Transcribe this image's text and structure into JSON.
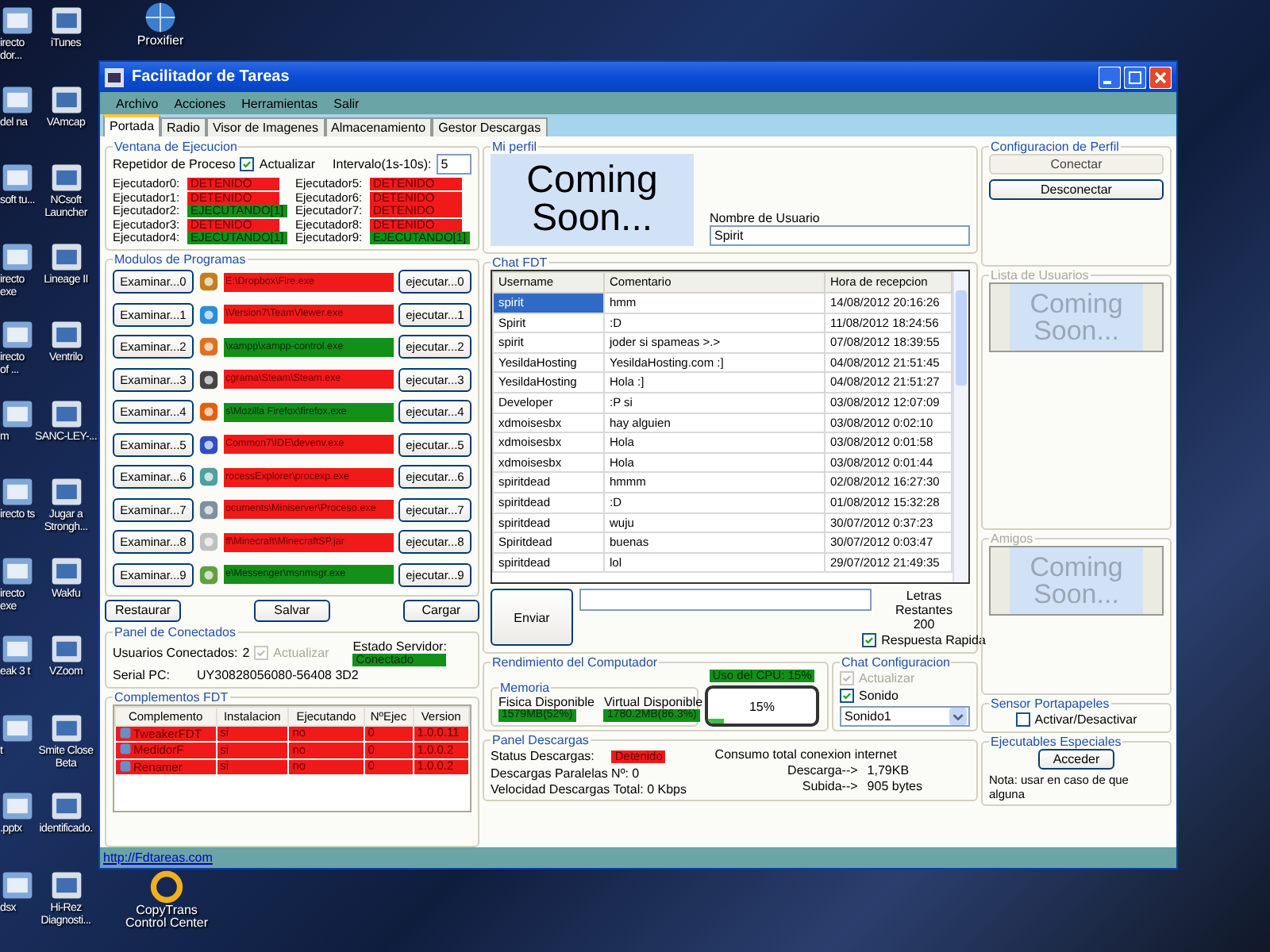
{
  "desktop": {
    "left_column": [
      {
        "label": "irecto dor..."
      },
      {
        "label": "del na"
      },
      {
        "label": "soft tu..."
      },
      {
        "label": "irecto exe"
      },
      {
        "label": "irecto of ..."
      },
      {
        "label": "m"
      },
      {
        "label": "irecto ts"
      },
      {
        "label": "irecto exe"
      },
      {
        "label": "eak 3 t"
      },
      {
        "label": "t"
      },
      {
        "label": ".pptx"
      },
      {
        "label": "dsx"
      }
    ],
    "second_column": [
      {
        "label": "iTunes"
      },
      {
        "label": "VAmcap"
      },
      {
        "label": "NCsoft Launcher"
      },
      {
        "label": "Lineage II"
      },
      {
        "label": "Ventrilo"
      },
      {
        "label": "SANC-LEY-..."
      },
      {
        "label": "Jugar a Strongh..."
      },
      {
        "label": "Wakfu"
      },
      {
        "label": "VZoom"
      },
      {
        "label": "Smite Close Beta"
      },
      {
        "label": "identificado."
      },
      {
        "label": "Hi-Rez Diagnosti..."
      }
    ],
    "top_icons": [
      {
        "label": "Proxifier"
      }
    ],
    "bottom_icons": [
      {
        "label": "CopyTrans Control Center"
      }
    ]
  },
  "window": {
    "title": "Facilitador de Tareas",
    "menu": [
      "Archivo",
      "Acciones",
      "Herramientas",
      "Salir"
    ],
    "tabs": [
      {
        "label": "Portada",
        "selected": true
      },
      {
        "label": "Radio",
        "selected": false
      },
      {
        "label": "Visor de Imagenes",
        "selected": false
      },
      {
        "label": "Almacenamiento",
        "selected": false
      },
      {
        "label": "Gestor Descargas",
        "selected": false
      }
    ],
    "link": "http://Fdtareas.com"
  },
  "ventana_ejecucion": {
    "title": "Ventana de Ejecucion",
    "repetidor": "Repetidor de Proceso",
    "actualizar": {
      "label": "Actualizar",
      "checked": true
    },
    "intervalo_label": "Intervalo(1s-10s):",
    "intervalo": "5",
    "executors": [
      {
        "label": "Ejecutador0:",
        "status": "DETENIDO",
        "running": false
      },
      {
        "label": "Ejecutador1:",
        "status": "DETENIDO",
        "running": false
      },
      {
        "label": "Ejecutador2:",
        "status": "EJECUTANDO[1]",
        "running": true
      },
      {
        "label": "Ejecutador3:",
        "status": "DETENIDO",
        "running": false
      },
      {
        "label": "Ejecutador4:",
        "status": "EJECUTANDO[1]",
        "running": true
      },
      {
        "label": "Ejecutador5:",
        "status": "DETENIDO",
        "running": false
      },
      {
        "label": "Ejecutador6:",
        "status": "DETENIDO",
        "running": false
      },
      {
        "label": "Ejecutador7:",
        "status": "DETENIDO",
        "running": false
      },
      {
        "label": "Ejecutador8:",
        "status": "DETENIDO",
        "running": false
      },
      {
        "label": "Ejecutador9:",
        "status": "EJECUTANDO[1]",
        "running": true
      }
    ]
  },
  "modulos": {
    "title": "Modulos de Programas",
    "rows": [
      {
        "browse": "Examinar...0",
        "path": "E:\\Dropbox\\Fire.exe",
        "running": false,
        "run": "ejecutar...0"
      },
      {
        "browse": "Examinar...1",
        "path": "\\Version7\\TeamViewer.exe",
        "running": false,
        "run": "ejecutar...1"
      },
      {
        "browse": "Examinar...2",
        "path": "\\xampp\\xampp-control.exe",
        "running": true,
        "run": "ejecutar...2"
      },
      {
        "browse": "Examinar...3",
        "path": "cgrama\\Steam\\Steam.exe",
        "running": false,
        "run": "ejecutar...3"
      },
      {
        "browse": "Examinar...4",
        "path": "s\\Mozilla Firefox\\firefox.exe",
        "running": true,
        "run": "ejecutar...4"
      },
      {
        "browse": "Examinar...5",
        "path": "Common7\\IDE\\devenv.exe",
        "running": false,
        "run": "ejecutar...5"
      },
      {
        "browse": "Examinar...6",
        "path": "rocessExplorer\\procexp.exe",
        "running": false,
        "run": "ejecutar...6"
      },
      {
        "browse": "Examinar...7",
        "path": "ocuments\\Miniserver\\Proceso.exe",
        "running": false,
        "run": "ejecutar...7"
      },
      {
        "browse": "Examinar...8",
        "path": "ff\\Minecraft\\MinecraftSP.jar",
        "running": false,
        "run": "ejecutar...8"
      },
      {
        "browse": "Examinar...9",
        "path": "e\\Messenger\\msnmsgr.exe",
        "running": true,
        "run": "ejecutar...9"
      }
    ],
    "buttons": [
      "Restaurar",
      "Salvar",
      "Cargar"
    ]
  },
  "conectados": {
    "title": "Panel de Conectados",
    "usuarios_label": "Usuarios Conectados:",
    "usuarios": "2",
    "actualizar": {
      "label": "Actualizar",
      "checked": true,
      "disabled": true
    },
    "estado_label": "Estado Servidor:",
    "estado": "Conectado",
    "estado_ok": true,
    "serial_label": "Serial PC:",
    "serial": "UY30828056080-56408 3D2"
  },
  "complementos": {
    "title": "Complementos FDT",
    "columns": [
      "Complemento",
      "Instalacion",
      "Ejecutando",
      "NºEjec",
      "Version"
    ],
    "rows": [
      {
        "cells": [
          "TweakerFDT",
          "si",
          "no",
          "0",
          "1.0.0.11"
        ],
        "running": false
      },
      {
        "cells": [
          "MedidorF",
          "si",
          "no",
          "0",
          "1.0.0.2"
        ],
        "running": false
      },
      {
        "cells": [
          "Renamer",
          "si",
          "no",
          "0",
          "1.0.0.2"
        ],
        "running": false
      }
    ]
  },
  "perfil": {
    "title": "Mi perfil",
    "coming_soon": "Coming Soon...",
    "usuario_label": "Nombre de Usuario",
    "usuario": "Spirit"
  },
  "chat": {
    "title": "Chat FDT",
    "columns": [
      "Username",
      "Comentario",
      "Hora de recepcion"
    ],
    "rows": [
      {
        "username": "spirit",
        "comment": "hmm",
        "time": "14/08/2012 20:16:26",
        "selected": true
      },
      {
        "username": "Spirit",
        "comment": ":D",
        "time": "11/08/2012 18:24:56",
        "selected": false
      },
      {
        "username": "spirit",
        "comment": "joder si spameas >.>",
        "time": "07/08/2012 18:39:55",
        "selected": false
      },
      {
        "username": "YesildaHosting",
        "comment": "YesildaHosting.com :]",
        "time": "04/08/2012 21:51:45",
        "selected": false
      },
      {
        "username": "YesildaHosting",
        "comment": "Hola :]",
        "time": "04/08/2012 21:51:27",
        "selected": false
      },
      {
        "username": "Developer",
        "comment": ":P si",
        "time": "03/08/2012 12:07:09",
        "selected": false
      },
      {
        "username": "xdmoisesbx",
        "comment": "hay alguien",
        "time": "03/08/2012 0:02:10",
        "selected": false
      },
      {
        "username": "xdmoisesbx",
        "comment": "Hola",
        "time": "03/08/2012 0:01:58",
        "selected": false
      },
      {
        "username": "xdmoisesbx",
        "comment": "Hola",
        "time": "03/08/2012 0:01:44",
        "selected": false
      },
      {
        "username": "spiritdead",
        "comment": "hmmm",
        "time": "02/08/2012 16:27:30",
        "selected": false
      },
      {
        "username": "spiritdead",
        "comment": ":D",
        "time": "01/08/2012 15:32:28",
        "selected": false
      },
      {
        "username": "spiritdead",
        "comment": "wuju",
        "time": "30/07/2012 0:37:23",
        "selected": false
      },
      {
        "username": "Spiritdead",
        "comment": "buenas",
        "time": "30/07/2012 0:03:47",
        "selected": false
      },
      {
        "username": "spiritdead",
        "comment": "lol",
        "time": "29/07/2012 21:49:35",
        "selected": false
      }
    ],
    "send": "Enviar",
    "letras_label": "Letras Restantes",
    "letras": "200",
    "respuesta": {
      "label": "Respuesta Rapida",
      "checked": true
    }
  },
  "rendimiento": {
    "title": "Rendimiento del Computador",
    "memoria": "Memoria",
    "fisica_label": "Fisica Disponible",
    "fisica": "1579MB(52%)",
    "virtual_label": "Virtual Disponible",
    "virtual": "1780.2MB(86.3%)",
    "cpu_label": "Uso del CPU: 15%",
    "cpu": {
      "reading": "15%",
      "level": 0.15
    }
  },
  "chat_config": {
    "title": "Chat Configuracion",
    "actualizar": {
      "label": "Actualizar",
      "checked": true,
      "disabled": true
    },
    "sonido": {
      "label": "Sonido",
      "checked": true,
      "disabled": false
    },
    "sound": "Sonido1"
  },
  "descargas": {
    "title": "Panel Descargas",
    "status_label": "Status Descargas:",
    "status": "Detenido",
    "status_ok": false,
    "paralelas": "Descargas Paralelas Nº: 0",
    "velocidad": "Velocidad Descargas Total: 0 Kbps",
    "consumo": "Consumo total conexion internet",
    "descarga_label": "Descarga-->",
    "descarga": "1,79KB",
    "subida_label": "Subida-->",
    "subida": "905 bytes"
  },
  "config_perfil": {
    "title": "Configuracion de Perfil",
    "conectar": {
      "label": "Conectar",
      "disabled": true
    },
    "desconectar": {
      "label": "Desconectar",
      "disabled": false
    }
  },
  "lista_usuarios": {
    "title": "Lista de Usuarios",
    "coming_soon": "Coming Soon..."
  },
  "amigos": {
    "title": "Amigos",
    "coming_soon": "Coming Soon..."
  },
  "sensor": {
    "title": "Sensor Portapapeles",
    "checkbox": {
      "label": "Activar/Desactivar",
      "checked": false
    }
  },
  "especiales": {
    "title": "Ejecutables Especiales",
    "button": "Acceder",
    "note": "Nota: usar en caso de que alguna"
  }
}
